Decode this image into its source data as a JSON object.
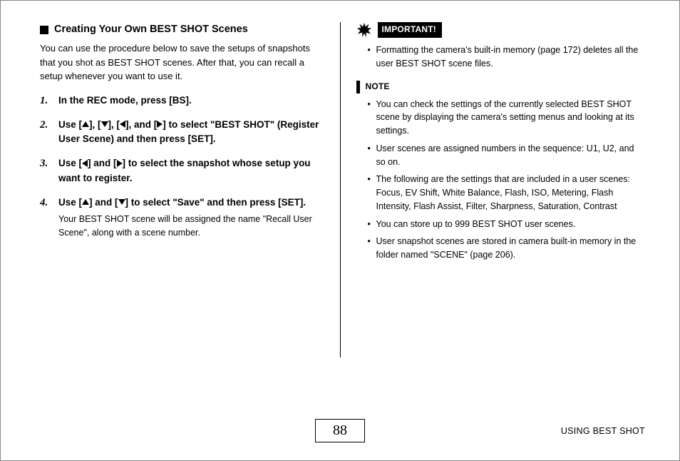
{
  "left": {
    "heading": "Creating Your Own BEST SHOT Scenes",
    "intro": "You can use the procedure below to save the setups of snapshots that you shot as BEST SHOT scenes. After that, you can recall a setup whenever you want to use it.",
    "steps": [
      {
        "head_pre": "In the REC mode, press [BS].",
        "body": ""
      },
      {
        "head_pre": "Use [",
        "arrows": [
          "up",
          "down",
          "left",
          "right"
        ],
        "head_post": "] to select \"BEST SHOT\" (Register User Scene) and then press [SET].",
        "body": ""
      },
      {
        "head_pre": "Use [",
        "arrows": [
          "left",
          "right"
        ],
        "head_post": "] to select the snapshot whose setup you want to register.",
        "body": ""
      },
      {
        "head_pre": "Use [",
        "arrows": [
          "up",
          "down"
        ],
        "head_post": "] to select \"Save\" and then press [SET].",
        "body": "Your BEST SHOT scene will be assigned the name \"Recall User Scene\", along with a scene number."
      }
    ]
  },
  "right": {
    "important_label": "IMPORTANT!",
    "important_items": [
      "Formatting the camera's built-in memory (page 172) deletes all the user BEST SHOT scene files."
    ],
    "note_label": "NOTE",
    "note_items": [
      {
        "text": "You can check the settings of the currently selected BEST SHOT scene by displaying the camera's setting menus and looking at its settings."
      },
      {
        "text": "User scenes are assigned numbers in the sequence: U1, U2, and so on."
      },
      {
        "text": "The following are the settings that are included in a user scenes:",
        "sub": "Focus, EV Shift, White Balance, Flash, ISO, Metering, Flash Intensity, Flash Assist, Filter, Sharpness, Saturation, Contrast"
      },
      {
        "text": "You can store up to 999 BEST SHOT user scenes."
      },
      {
        "text": "User snapshot scenes are stored in camera built-in memory in the folder named \"SCENE\" (page 206)."
      }
    ]
  },
  "footer": {
    "page_number": "88",
    "section": "USING BEST SHOT"
  }
}
